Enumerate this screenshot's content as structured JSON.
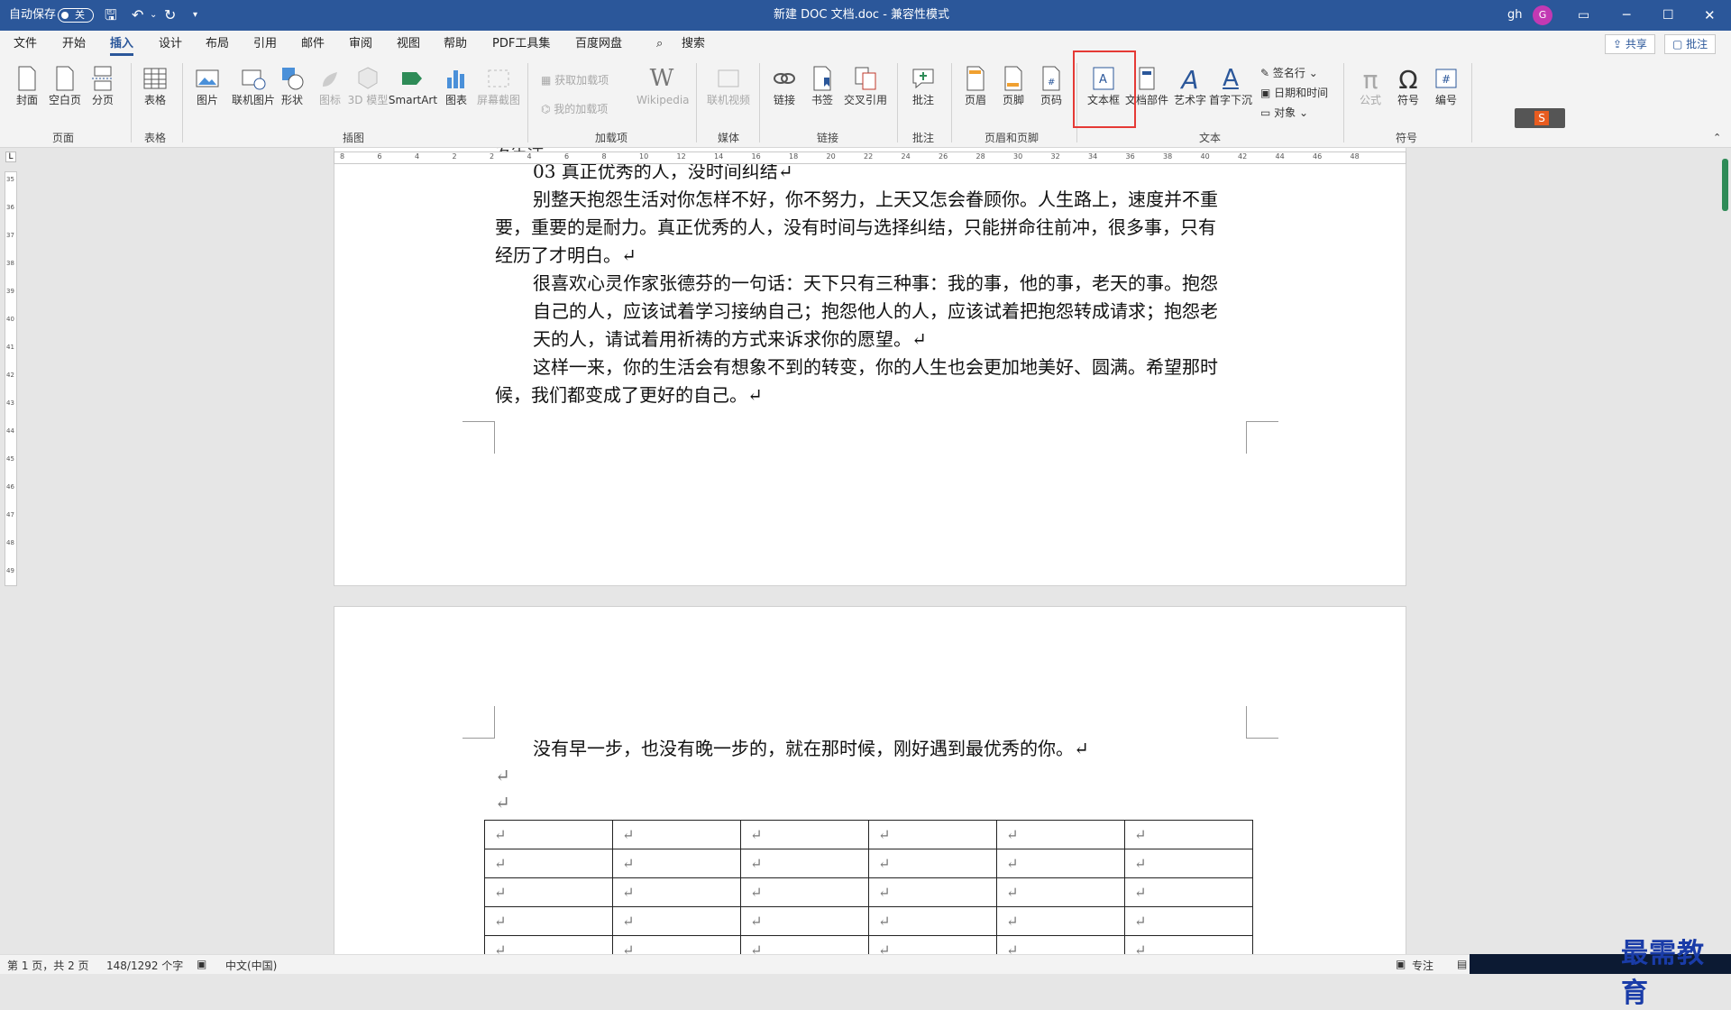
{
  "titlebar": {
    "autosave_label": "自动保存",
    "autosave_state": "关",
    "doc_title": "新建 DOC 文档.doc  -  兼容性模式",
    "user_initials": "gh",
    "avatar_letter": "G",
    "accent": "#2b579a"
  },
  "tabs": [
    "文件",
    "开始",
    "插入",
    "设计",
    "布局",
    "引用",
    "邮件",
    "审阅",
    "视图",
    "帮助",
    "PDF工具集",
    "百度网盘"
  ],
  "active_tab": "插入",
  "search_label": "搜索",
  "share_label": "共享",
  "comment_label": "批注",
  "ribbon": {
    "pages": [
      "封面",
      "空白页",
      "分页"
    ],
    "table": "表格",
    "illustrations": [
      "图片",
      "联机图片",
      "形状",
      "图标",
      "3D 模型",
      "SmartArt",
      "图表",
      "屏幕截图"
    ],
    "addins": [
      "获取加载项",
      "我的加载项",
      "Wikipedia"
    ],
    "media": "联机视频",
    "links": [
      "链接",
      "书签",
      "交叉引用"
    ],
    "comment": "批注",
    "header_footer": [
      "页眉",
      "页脚",
      "页码"
    ],
    "text": [
      "文本框",
      "文档部件",
      "艺术字",
      "首字下沉"
    ],
    "text_small": [
      "签名行",
      "日期和时间",
      "对象"
    ],
    "symbols": [
      "公式",
      "符号",
      "编号"
    ],
    "groups": [
      "页面",
      "表格",
      "插图",
      "加载项",
      "媒体",
      "链接",
      "批注",
      "页眉和页脚",
      "文本",
      "符号"
    ]
  },
  "ruler": {
    "h_ticks": [
      "8",
      "6",
      "4",
      "2",
      "2",
      "4",
      "6",
      "8",
      "10",
      "12",
      "14",
      "16",
      "18",
      "20",
      "22",
      "24",
      "26",
      "28",
      "30",
      "32",
      "34",
      "36",
      "38",
      "40",
      "42",
      "44",
      "46",
      "48"
    ],
    "v_ticks": [
      "35",
      "36",
      "37",
      "38",
      "39",
      "40",
      "41",
      "42",
      "43",
      "44",
      "45",
      "46",
      "47",
      "48",
      "49"
    ]
  },
  "page1": {
    "cut_top": "发生活。",
    "heading": "03  真正优秀的人，没时间纠结↵",
    "para1_l1": "别整天抱怨生活对你怎样不好，你不努力，上天又怎会眷顾你。人生路上，速度并不重",
    "para1_l2": "要，重要的是耐力。真正优秀的人，没有时间与选择纠结，只能拼命往前冲，很多事，只有",
    "para1_l3": "经历了才明白。↵",
    "para2_l1": "很喜欢心灵作家张德芬的一句话：天下只有三种事：我的事，他的事，老天的事。抱怨",
    "para2_l2": "自己的人，应该试着学习接纳自己；抱怨他人的人，应该试着把抱怨转成请求；抱怨老",
    "para2_l3": "天的人，请试着用祈祷的方式来诉求你的愿望。↵",
    "para3_l1": "这样一来，你的生活会有想象不到的转变，你的人生也会更加地美好、圆满。希望那时",
    "para3_l2": "候，我们都变成了更好的自己。↵"
  },
  "page2": {
    "line1": "没有早一步，也没有晚一步的，就在那时候，刚好遇到最优秀的你。↵",
    "empty_mark": "↵",
    "table_mark": "↵",
    "table_rows": 5,
    "table_cols": 6
  },
  "statusbar": {
    "page": "第 1 页，共 2 页",
    "words": "148/1292 个字",
    "lang": "中文(中国)",
    "focus": "专注"
  },
  "watermark": "最需教育"
}
